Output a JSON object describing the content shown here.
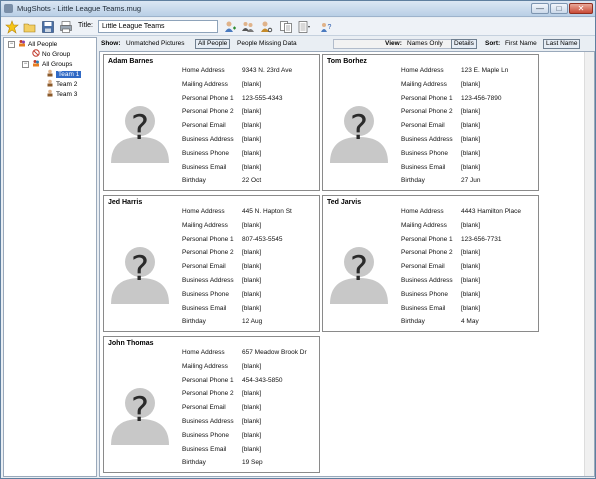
{
  "window": {
    "title": "MugShots - Little League Teams.mug",
    "min_glyph": "—",
    "max_glyph": "□",
    "close_glyph": "✕"
  },
  "toolbar": {
    "title_label": "Title:",
    "title_value": "Little League Teams",
    "icons": [
      "new-icon",
      "open-icon",
      "save-icon",
      "print-icon",
      "add-person-icon",
      "group-icon",
      "find-person-icon",
      "copy-icon",
      "report-icon",
      "help-icon"
    ]
  },
  "tree": {
    "all_people": "All People",
    "no_group": "No Group",
    "all_groups": "All Groups",
    "teams": [
      "Team 1",
      "Team 2",
      "Team 3"
    ],
    "selected": "Team 1"
  },
  "filters": {
    "show_label": "Show:",
    "unmatched": "Unmatched Pictures",
    "all_people": "All People",
    "missing_data": "People Missing Data",
    "view_label": "View:",
    "names_only": "Names Only",
    "details": "Details",
    "sort_label": "Sort:",
    "first_name": "First Name",
    "last_name": "Last Name",
    "active_show": "All People",
    "active_view": "Details",
    "active_sort": "Last Name"
  },
  "field_labels": [
    "Home Address",
    "Mailing Address",
    "Personal Phone 1",
    "Personal Phone 2",
    "Personal Email",
    "Business Address",
    "Business Phone",
    "Business Email",
    "Birthday"
  ],
  "people": [
    {
      "name": "Adam Barnes",
      "values": [
        "9343 N. 23rd Ave",
        "[blank]",
        "123-555-4343",
        "[blank]",
        "[blank]",
        "[blank]",
        "[blank]",
        "[blank]",
        "22 Oct"
      ]
    },
    {
      "name": "Tom Borhez",
      "values": [
        "123 E. Maple Ln",
        "[blank]",
        "123-456-7890",
        "[blank]",
        "[blank]",
        "[blank]",
        "[blank]",
        "[blank]",
        "27 Jun"
      ]
    },
    {
      "name": "Jed Harris",
      "values": [
        "445 N. Hapton St",
        "[blank]",
        "807-453-5545",
        "[blank]",
        "[blank]",
        "[blank]",
        "[blank]",
        "[blank]",
        "12 Aug"
      ]
    },
    {
      "name": "Ted Jarvis",
      "values": [
        "4443 Hamilton Place",
        "[blank]",
        "123-656-7731",
        "[blank]",
        "[blank]",
        "[blank]",
        "[blank]",
        "[blank]",
        "4 May"
      ]
    },
    {
      "name": "John Thomas",
      "values": [
        "657 Meadow Brook Dr",
        "[blank]",
        "454-343-5850",
        "[blank]",
        "[blank]",
        "[blank]",
        "[blank]",
        "[blank]",
        "19 Sep"
      ]
    }
  ],
  "colors": {
    "selection": "#316ac5",
    "silhouette": "#c8c8c8",
    "question_mark": "#2a2a2a"
  }
}
